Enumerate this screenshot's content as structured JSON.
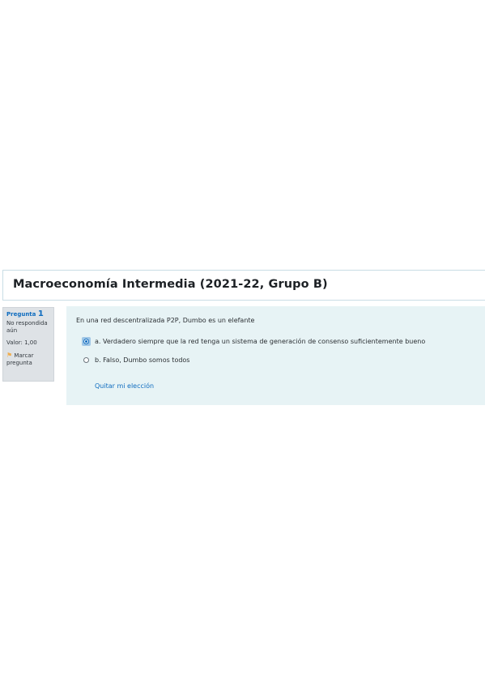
{
  "course": {
    "title": "Macroeconomía Intermedia (2021-22, Grupo B)"
  },
  "question_info": {
    "label": "Pregunta",
    "number": "1",
    "state": "No respondida aún",
    "grade": "Valor: 1,00",
    "flag_label": "Marcar pregunta",
    "flag_icon": "flag-icon"
  },
  "question": {
    "text": "En una red descentralizada P2P, Dumbo es un elefante",
    "answers": [
      {
        "label": "a. Verdadero siempre que la red tenga un sistema de generación de consenso suficientemente bueno",
        "selected": true
      },
      {
        "label": "b. Falso, Dumbo somos todos",
        "selected": false
      }
    ],
    "clear_choice": "Quitar mi elección"
  },
  "colors": {
    "link": "#0f6cbf",
    "content_bg": "#e7f3f5",
    "info_bg": "#dee2e6"
  }
}
